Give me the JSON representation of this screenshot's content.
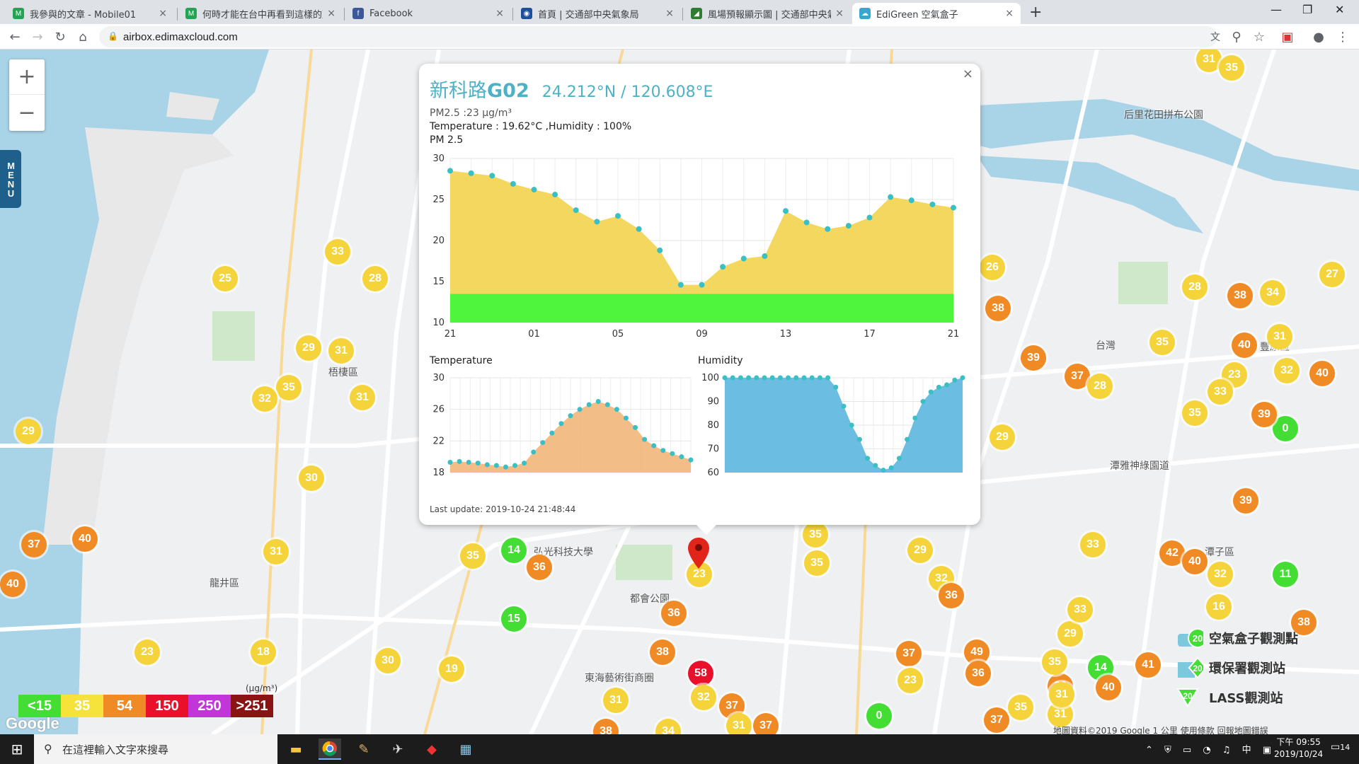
{
  "browser": {
    "tabs": [
      {
        "title": "我參與的文章 - Mobile01",
        "icon": "mobile01-icon",
        "color": "#23a455"
      },
      {
        "title": "何時才能在台中再看到這樣的藍",
        "icon": "mobile01-icon",
        "color": "#23a455"
      },
      {
        "title": "Facebook",
        "icon": "facebook-icon",
        "color": "#3b5998"
      },
      {
        "title": "首頁 | 交通部中央氣象局",
        "icon": "cwb-icon",
        "color": "#1d4f9a"
      },
      {
        "title": "風場預報顯示圖 | 交通部中央氣象",
        "icon": "cwb-icon",
        "color": "#2e7d32"
      },
      {
        "title": "EdiGreen 空氣盒子",
        "icon": "edigreen-icon",
        "color": "#3aa6d0"
      }
    ],
    "url": "airbox.edimaxcloud.com"
  },
  "map": {
    "zoom_in": "+",
    "zoom_out": "−",
    "menu_label": "MENU",
    "places": [
      "梧棲區",
      "龍井區",
      "弘光科技大學",
      "都會公園",
      "東海藝術街商圈",
      "潭子區",
      "后里花田拼布公園",
      "台灣",
      "豐原區",
      "潭雅神綠園道"
    ],
    "markers": [
      {
        "v": "31",
        "c": "y"
      },
      {
        "v": "35",
        "c": "y"
      },
      {
        "v": "33",
        "c": "y"
      },
      {
        "v": "28",
        "c": "y"
      },
      {
        "v": "25",
        "c": "y"
      },
      {
        "v": "29",
        "c": "y"
      },
      {
        "v": "31",
        "c": "y"
      },
      {
        "v": "35",
        "c": "y"
      },
      {
        "v": "32",
        "c": "y"
      },
      {
        "v": "31",
        "c": "y"
      },
      {
        "v": "29",
        "c": "y"
      },
      {
        "v": "30",
        "c": "y"
      },
      {
        "v": "37",
        "c": "o"
      },
      {
        "v": "40",
        "c": "o"
      },
      {
        "v": "40",
        "c": "o"
      },
      {
        "v": "31",
        "c": "y"
      },
      {
        "v": "23",
        "c": "y"
      },
      {
        "v": "18",
        "c": "y"
      },
      {
        "v": "30",
        "c": "y"
      },
      {
        "v": "19",
        "c": "y"
      },
      {
        "v": "35",
        "c": "y"
      },
      {
        "v": "14",
        "c": "g"
      },
      {
        "v": "36",
        "c": "o"
      },
      {
        "v": "15",
        "c": "g"
      },
      {
        "v": "23",
        "c": "y"
      },
      {
        "v": "36",
        "c": "o"
      },
      {
        "v": "38",
        "c": "o"
      },
      {
        "v": "58",
        "c": "r"
      },
      {
        "v": "32",
        "c": "y"
      },
      {
        "v": "31",
        "c": "y"
      },
      {
        "v": "37",
        "c": "o"
      },
      {
        "v": "31",
        "c": "y"
      },
      {
        "v": "37",
        "c": "o"
      },
      {
        "v": "38",
        "c": "o"
      },
      {
        "v": "34",
        "c": "y"
      },
      {
        "v": "35",
        "c": "y"
      },
      {
        "v": "35",
        "c": "y"
      },
      {
        "v": "29",
        "c": "y"
      },
      {
        "v": "32",
        "c": "y"
      },
      {
        "v": "36",
        "c": "o"
      },
      {
        "v": "37",
        "c": "o"
      },
      {
        "v": "23",
        "c": "y"
      },
      {
        "v": "49",
        "c": "o"
      },
      {
        "v": "36",
        "c": "o"
      },
      {
        "v": "0",
        "c": "g"
      },
      {
        "v": "37",
        "c": "o"
      },
      {
        "v": "26",
        "c": "y"
      },
      {
        "v": "38",
        "c": "o"
      },
      {
        "v": "39",
        "c": "o"
      },
      {
        "v": "37",
        "c": "o"
      },
      {
        "v": "28",
        "c": "y"
      },
      {
        "v": "29",
        "c": "y"
      },
      {
        "v": "35",
        "c": "y"
      },
      {
        "v": "28",
        "c": "y"
      },
      {
        "v": "38",
        "c": "o"
      },
      {
        "v": "34",
        "c": "y"
      },
      {
        "v": "27",
        "c": "y"
      },
      {
        "v": "40",
        "c": "o"
      },
      {
        "v": "31",
        "c": "y"
      },
      {
        "v": "23",
        "c": "y"
      },
      {
        "v": "32",
        "c": "y"
      },
      {
        "v": "40",
        "c": "o"
      },
      {
        "v": "33",
        "c": "y"
      },
      {
        "v": "35",
        "c": "y"
      },
      {
        "v": "30",
        "c": "y"
      },
      {
        "v": "0",
        "c": "g"
      },
      {
        "v": "39",
        "c": "o"
      },
      {
        "v": "33",
        "c": "y"
      },
      {
        "v": "42",
        "c": "o"
      },
      {
        "v": "40",
        "c": "o"
      },
      {
        "v": "32",
        "c": "y"
      },
      {
        "v": "16",
        "c": "y"
      },
      {
        "v": "11",
        "c": "g"
      },
      {
        "v": "38",
        "c": "o"
      },
      {
        "v": "14",
        "c": "g"
      },
      {
        "v": "41",
        "c": "o"
      },
      {
        "v": "36",
        "c": "o"
      },
      {
        "v": "40",
        "c": "o"
      },
      {
        "v": "31",
        "c": "y"
      },
      {
        "v": "35",
        "c": "y"
      },
      {
        "v": "31",
        "c": "y"
      },
      {
        "v": "35",
        "c": "y"
      },
      {
        "v": "29",
        "c": "y"
      },
      {
        "v": "33",
        "c": "y"
      },
      {
        "v": "39",
        "c": "o"
      }
    ],
    "legend": {
      "unit": "(μg/m³)",
      "items": [
        {
          "label": "<15",
          "color": "#44dd33"
        },
        {
          "label": "35",
          "color": "#f5e23a"
        },
        {
          "label": "54",
          "color": "#f08a24"
        },
        {
          "label": "150",
          "color": "#e8102b"
        },
        {
          "label": "250",
          "color": "#c235d8"
        },
        {
          "label": ">251",
          "color": "#8a1414"
        }
      ]
    },
    "stations": [
      {
        "label": "空氣盒子觀測點",
        "value": "20"
      },
      {
        "label": "環保署觀測站",
        "value": "20"
      },
      {
        "label": "LASS觀測站",
        "value": "20"
      }
    ],
    "attribution": "地圖資料©2019 Google   1 公里   使用條款   回報地圖錯誤"
  },
  "popup": {
    "name_prefix": "新科路",
    "name_bold": "G02",
    "coords": "24.212°N / 120.608°E",
    "pm_line": "PM2.5 :23 μg/m³",
    "temp_line": "Temperature : 19.62°C ,Humidity : 100%",
    "pm_chart_label": "PM 2.5",
    "temp_chart_label": "Temperature",
    "hum_chart_label": "Humidity",
    "last_update": "Last update: 2019-10-24 21:48:44",
    "close": "×"
  },
  "chart_data": [
    {
      "type": "area",
      "title": "PM 2.5",
      "x": [
        "21",
        "",
        "",
        "",
        "01",
        "",
        "",
        "",
        "05",
        "",
        "",
        "",
        "09",
        "",
        "",
        "",
        "13",
        "",
        "",
        "",
        "17",
        "",
        "",
        "",
        "21"
      ],
      "xticks": [
        "21",
        "01",
        "05",
        "09",
        "13",
        "17",
        "21"
      ],
      "series": [
        {
          "values": [
            28.5,
            28.2,
            27.9,
            26.9,
            26.2,
            25.6,
            23.7,
            22.3,
            23.0,
            21.4,
            18.8,
            14.6,
            14.6,
            16.8,
            17.8,
            18.1,
            23.6,
            22.2,
            21.4,
            21.8,
            22.8,
            25.3,
            24.9,
            24.4,
            24.0
          ]
        }
      ],
      "ylim": [
        10,
        30
      ],
      "yticks": [
        10,
        15,
        20,
        25,
        30
      ],
      "colors": {
        "fill": "#f4d75f",
        "point": "#3ac0c4",
        "band": "#4ef53c"
      },
      "band_max": 13.5
    },
    {
      "type": "area",
      "title": "Temperature",
      "series": [
        {
          "values": [
            19.3,
            19.4,
            19.3,
            19.2,
            19.0,
            18.9,
            18.7,
            18.9,
            19.2,
            20.6,
            21.8,
            23.0,
            24.2,
            25.2,
            26.0,
            26.6,
            27.0,
            26.6,
            26.0,
            24.9,
            23.7,
            22.2,
            21.4,
            20.8,
            20.4,
            20.0,
            19.6
          ]
        }
      ],
      "ylim": [
        18,
        30
      ],
      "yticks": [
        18,
        22,
        26,
        30
      ],
      "colors": {
        "fill": "#f2b67a",
        "point": "#3ac0c4"
      }
    },
    {
      "type": "area",
      "title": "Humidity",
      "series": [
        {
          "values": [
            100,
            100,
            100,
            100,
            100,
            100,
            100,
            100,
            100,
            100,
            100,
            100,
            100,
            100,
            96,
            88,
            80,
            74,
            66,
            63,
            61,
            62,
            66,
            74,
            83,
            90,
            94,
            96,
            97,
            99,
            100
          ]
        }
      ],
      "ylim": [
        60,
        100
      ],
      "yticks": [
        60,
        70,
        80,
        90,
        100
      ],
      "colors": {
        "fill": "#6bbde2",
        "point": "#3ac0c4"
      }
    }
  ],
  "taskbar": {
    "search_placeholder": "在這裡輸入文字來搜尋",
    "time": "下午 09:55",
    "date": "2019/10/24",
    "notif_count": "14",
    "ime": "中"
  }
}
